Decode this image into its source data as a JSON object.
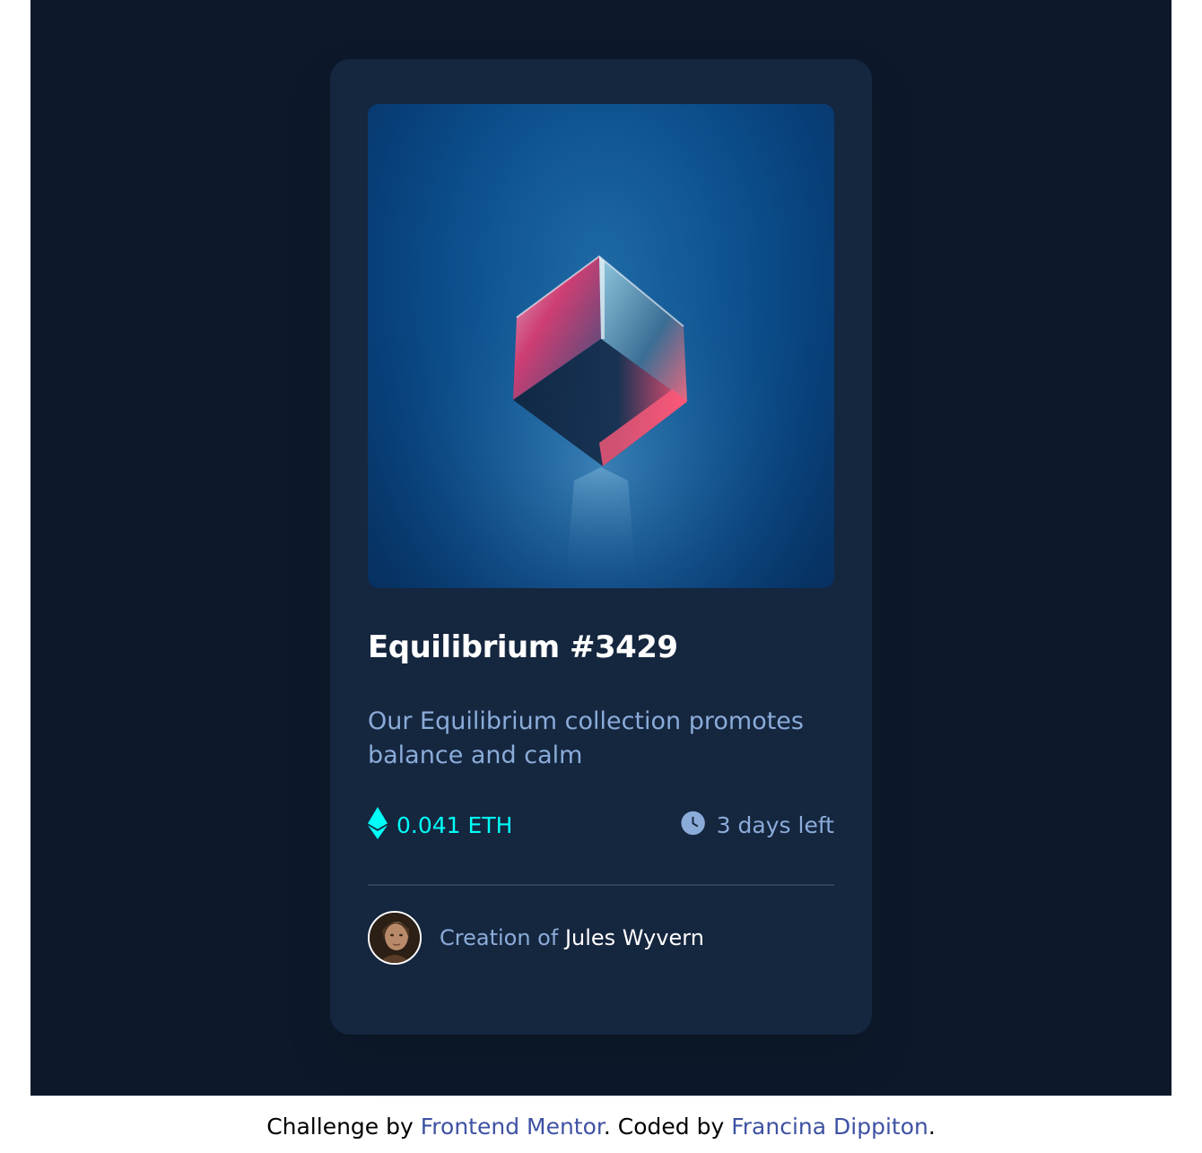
{
  "card": {
    "title": "Equilibrium #3429",
    "description": "Our Equilibrium collection promotes balance and calm",
    "price": "0.041 ETH",
    "time_left": "3 days left",
    "creator_prefix": "Creation of",
    "creator_name": "Jules Wyvern",
    "hero_image": "glowing-glass-cube-image",
    "icons": {
      "price": "ethereum-icon",
      "time": "clock-icon"
    }
  },
  "attribution": {
    "prefix": "Challenge by ",
    "link1": "Frontend Mentor",
    "middle": ". Coded by ",
    "link2": "Francina Dippiton",
    "suffix": "."
  },
  "colors": {
    "page_bg": "#0d192b",
    "card_bg": "#15263f",
    "cyan": "#00fff7",
    "soft_blue": "#8bacd9",
    "white": "#ffffff",
    "link": "#3e52a3"
  }
}
